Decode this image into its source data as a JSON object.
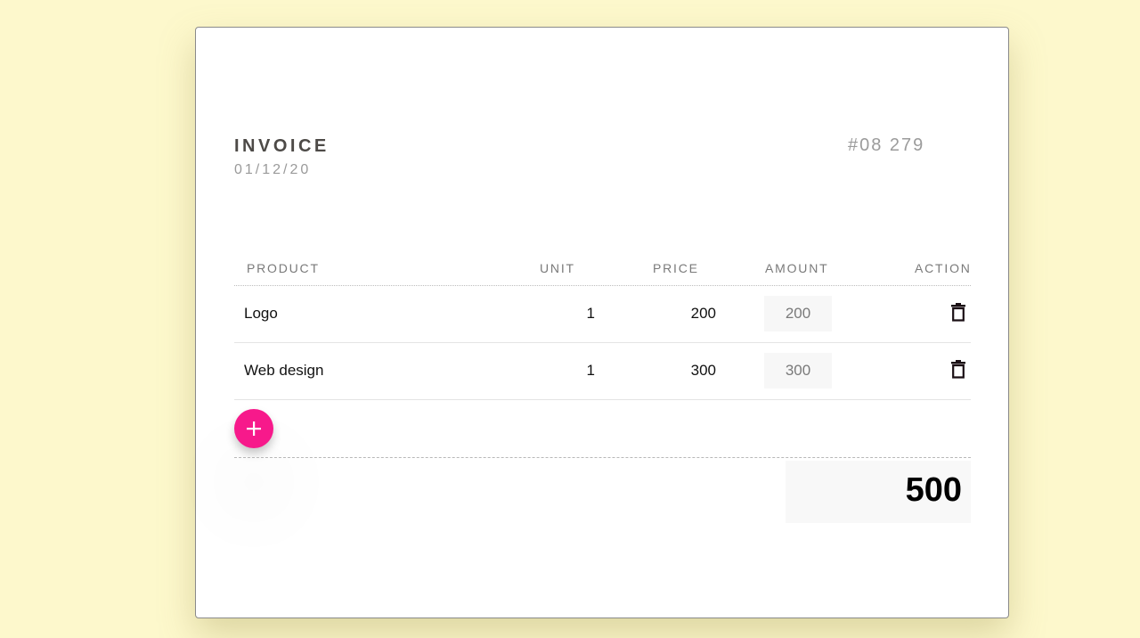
{
  "invoice": {
    "title": "INVOICE",
    "date": "01/12/20",
    "number": "#08 279"
  },
  "table": {
    "headers": {
      "product": "PRODUCT",
      "unit": "UNIT",
      "price": "PRICE",
      "amount": "AMOUNT",
      "action": "ACTION"
    },
    "rows": [
      {
        "product": "Logo",
        "unit": "1",
        "price": "200",
        "amount": "200"
      },
      {
        "product": "Web design",
        "unit": "1",
        "price": "300",
        "amount": "300"
      }
    ]
  },
  "total": "500",
  "icons": {
    "delete": "trash-icon",
    "add": "plus-icon"
  },
  "colors": {
    "background": "#fdf8cc",
    "accent": "#f7198b"
  }
}
